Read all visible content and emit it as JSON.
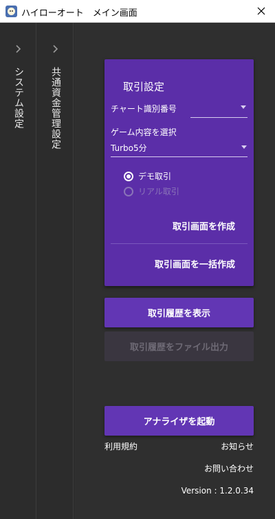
{
  "window": {
    "title": "ハイローオート　メイン画面",
    "app_icon": "app-face-icon",
    "close_icon": "close-icon"
  },
  "sidebar": {
    "items": [
      {
        "label": "システム設定",
        "icon": "chevron-right-icon"
      },
      {
        "label": "共通資金管理設定",
        "icon": "chevron-right-icon"
      }
    ]
  },
  "trade_settings": {
    "title": "取引設定",
    "chart_id": {
      "label": "チャート識別番号",
      "value": ""
    },
    "game": {
      "label": "ゲーム内容を選択",
      "value": "Turbo5分"
    },
    "mode": {
      "options": [
        {
          "label": "デモ取引",
          "selected": true,
          "enabled": true
        },
        {
          "label": "リアル取引",
          "selected": false,
          "enabled": false
        }
      ]
    },
    "create_label": "取引画面を作成",
    "bulk_create_label": "取引画面を一括作成"
  },
  "actions": {
    "history_label": "取引履歴を表示",
    "export_label": "取引履歴をファイル出力",
    "analyzer_label": "アナライザを起動"
  },
  "footer": {
    "terms": "利用規約",
    "news": "お知らせ",
    "contact": "お問い合わせ",
    "version": "Version : 1.2.0.34"
  },
  "colors": {
    "accent": "#5b2ea8",
    "button": "#6236b4",
    "background": "#2b2b2b"
  }
}
